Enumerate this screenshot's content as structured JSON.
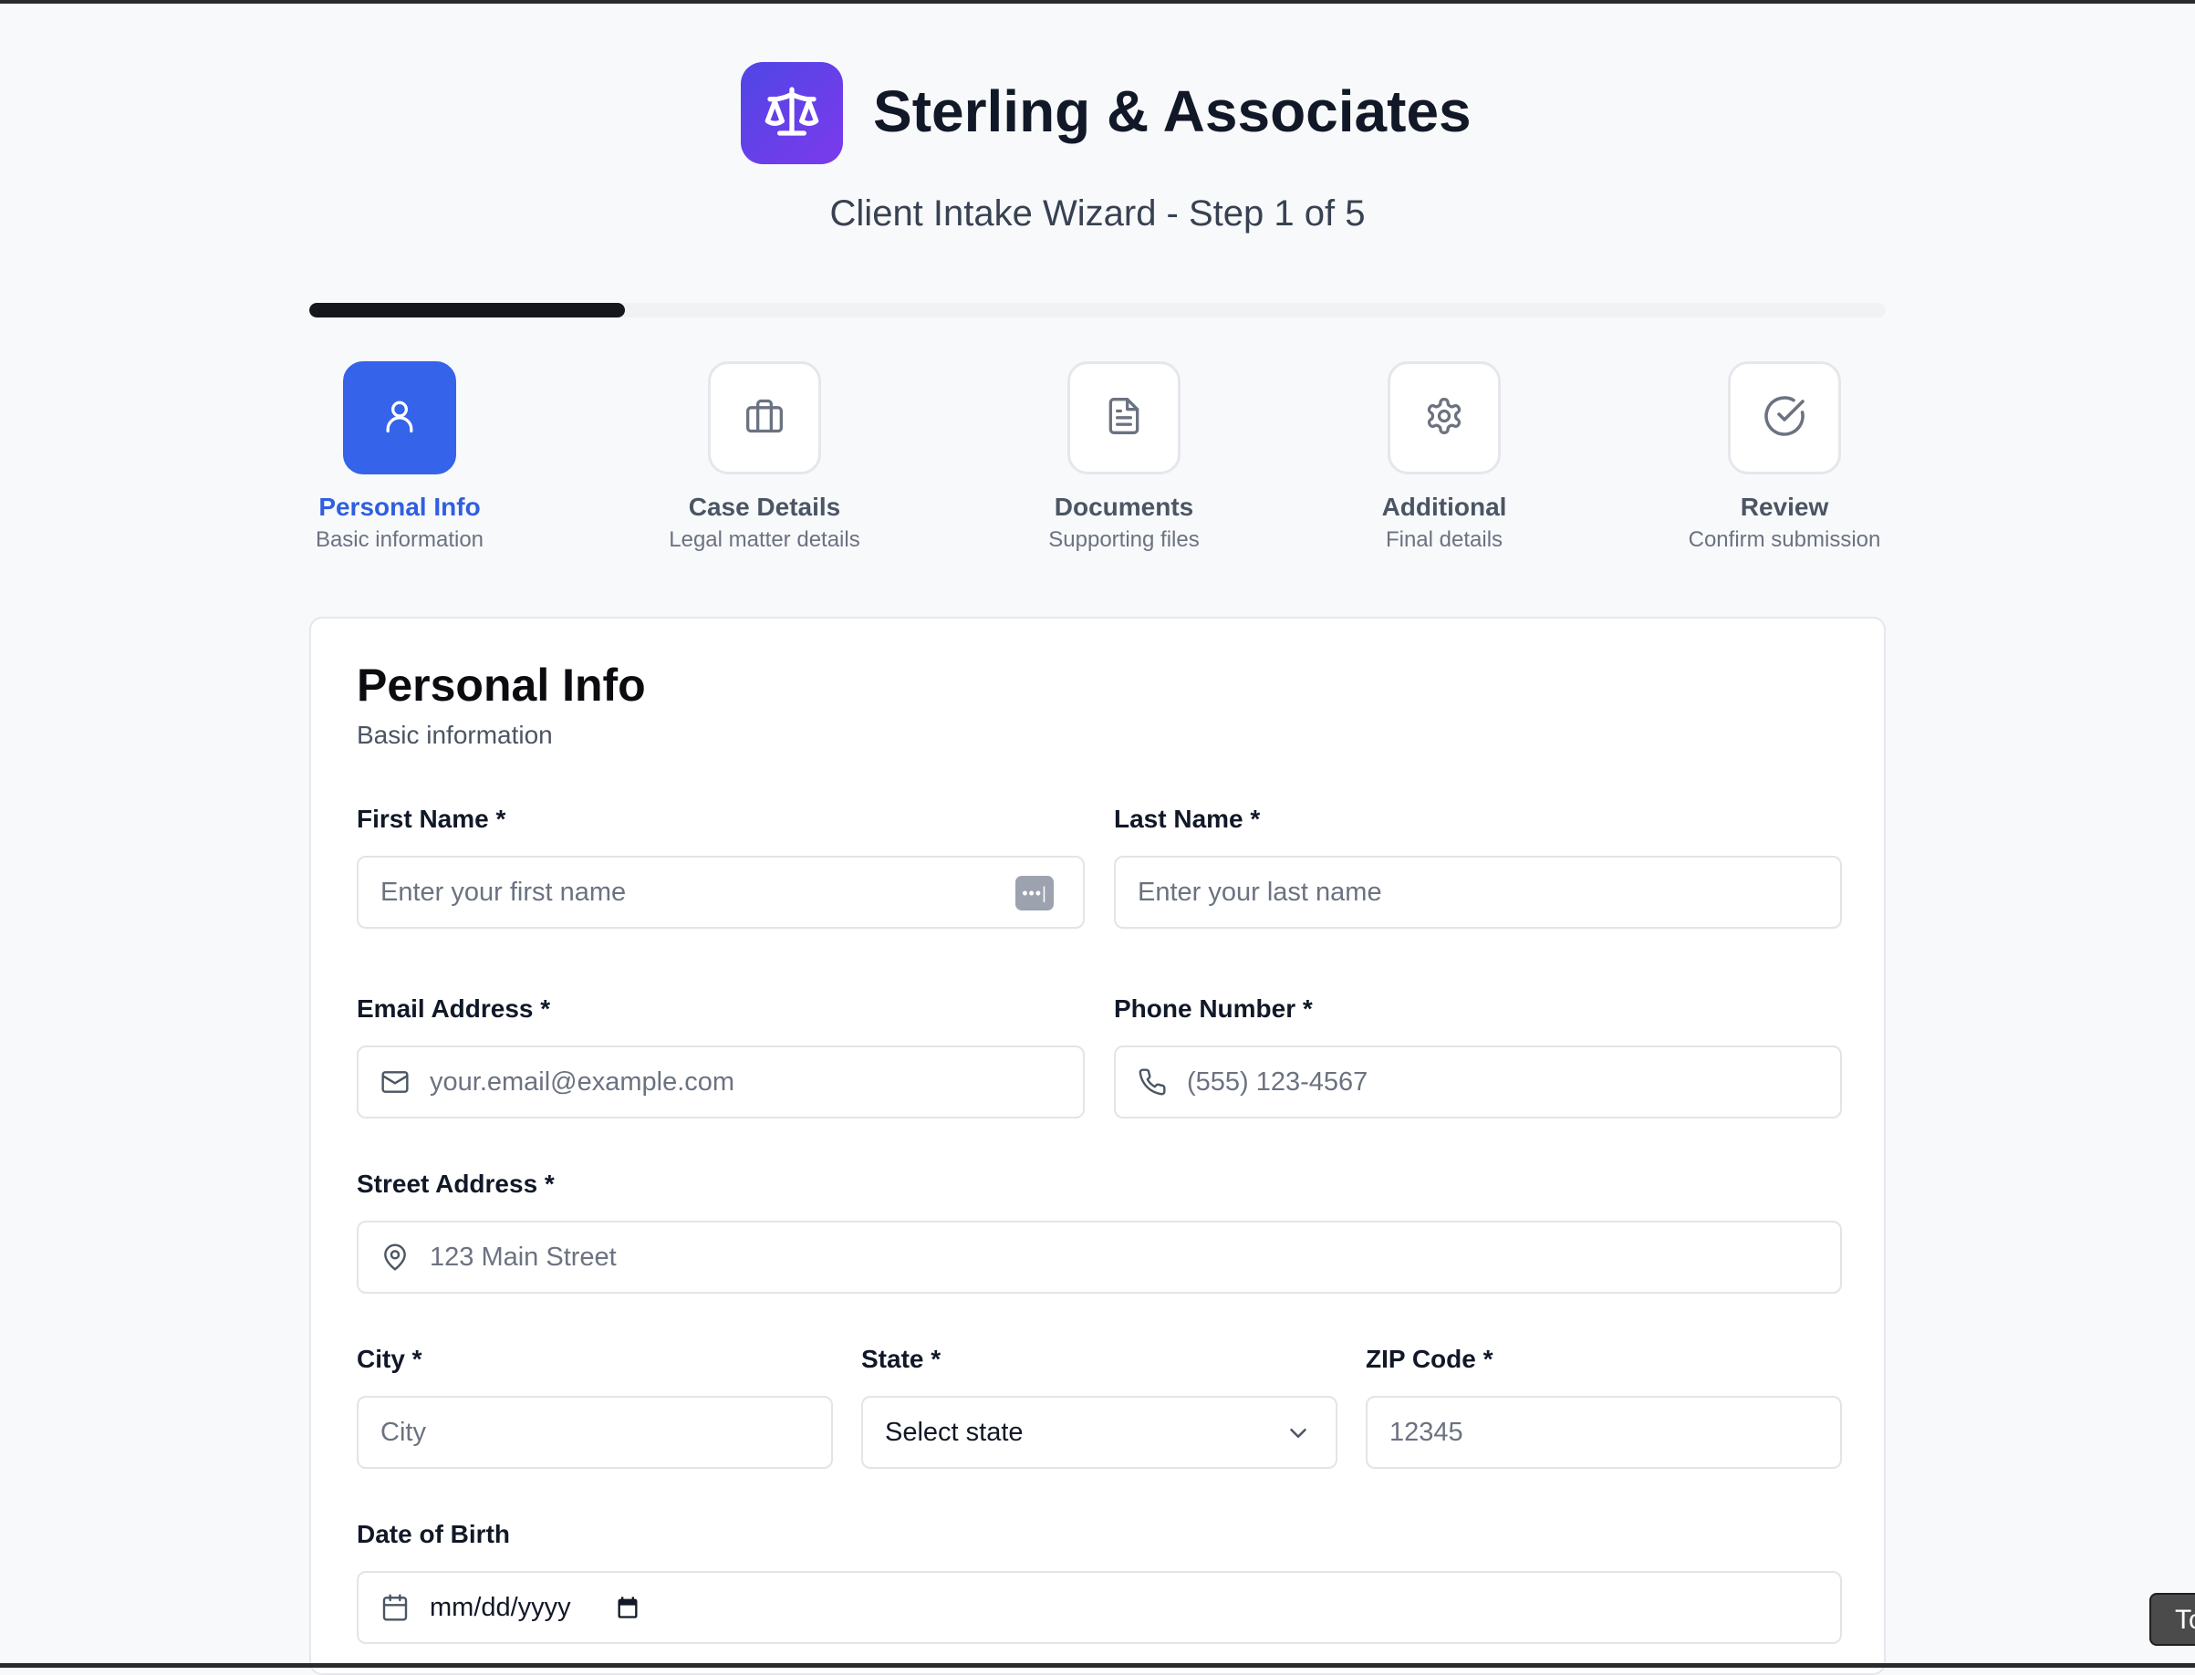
{
  "header": {
    "brand": "Sterling & Associates",
    "subtitle": "Client Intake Wizard - Step 1 of 5",
    "logo_icon": "scale-icon"
  },
  "progress": {
    "current_step": 1,
    "total_steps": 5,
    "fraction": 0.2
  },
  "steps": [
    {
      "title": "Personal Info",
      "desc": "Basic information",
      "icon": "user-icon",
      "active": true
    },
    {
      "title": "Case Details",
      "desc": "Legal matter details",
      "icon": "briefcase-icon",
      "active": false
    },
    {
      "title": "Documents",
      "desc": "Supporting files",
      "icon": "file-text-icon",
      "active": false
    },
    {
      "title": "Additional",
      "desc": "Final details",
      "icon": "gear-icon",
      "active": false
    },
    {
      "title": "Review",
      "desc": "Confirm submission",
      "icon": "check-circle-icon",
      "active": false
    }
  ],
  "form": {
    "title": "Personal Info",
    "subtitle": "Basic information",
    "first_name": {
      "label": "First Name *",
      "placeholder": "Enter your first name",
      "value": ""
    },
    "last_name": {
      "label": "Last Name *",
      "placeholder": "Enter your last name",
      "value": ""
    },
    "email": {
      "label": "Email Address *",
      "placeholder": "your.email@example.com",
      "value": ""
    },
    "phone": {
      "label": "Phone Number *",
      "placeholder": "(555) 123-4567",
      "value": ""
    },
    "street": {
      "label": "Street Address *",
      "placeholder": "123 Main Street",
      "value": ""
    },
    "city": {
      "label": "City *",
      "placeholder": "City",
      "value": ""
    },
    "state": {
      "label": "State *",
      "selected": "Select state"
    },
    "zip": {
      "label": "ZIP Code *",
      "placeholder": "12345",
      "value": ""
    },
    "dob": {
      "label": "Date of Birth",
      "placeholder": "mm/dd/yyyy"
    }
  },
  "corner_tab": {
    "label": "To"
  },
  "colors": {
    "accent": "#3563e9",
    "logo_start": "#4f46e5",
    "logo_end": "#7c3aed",
    "progress": "#15171c"
  }
}
